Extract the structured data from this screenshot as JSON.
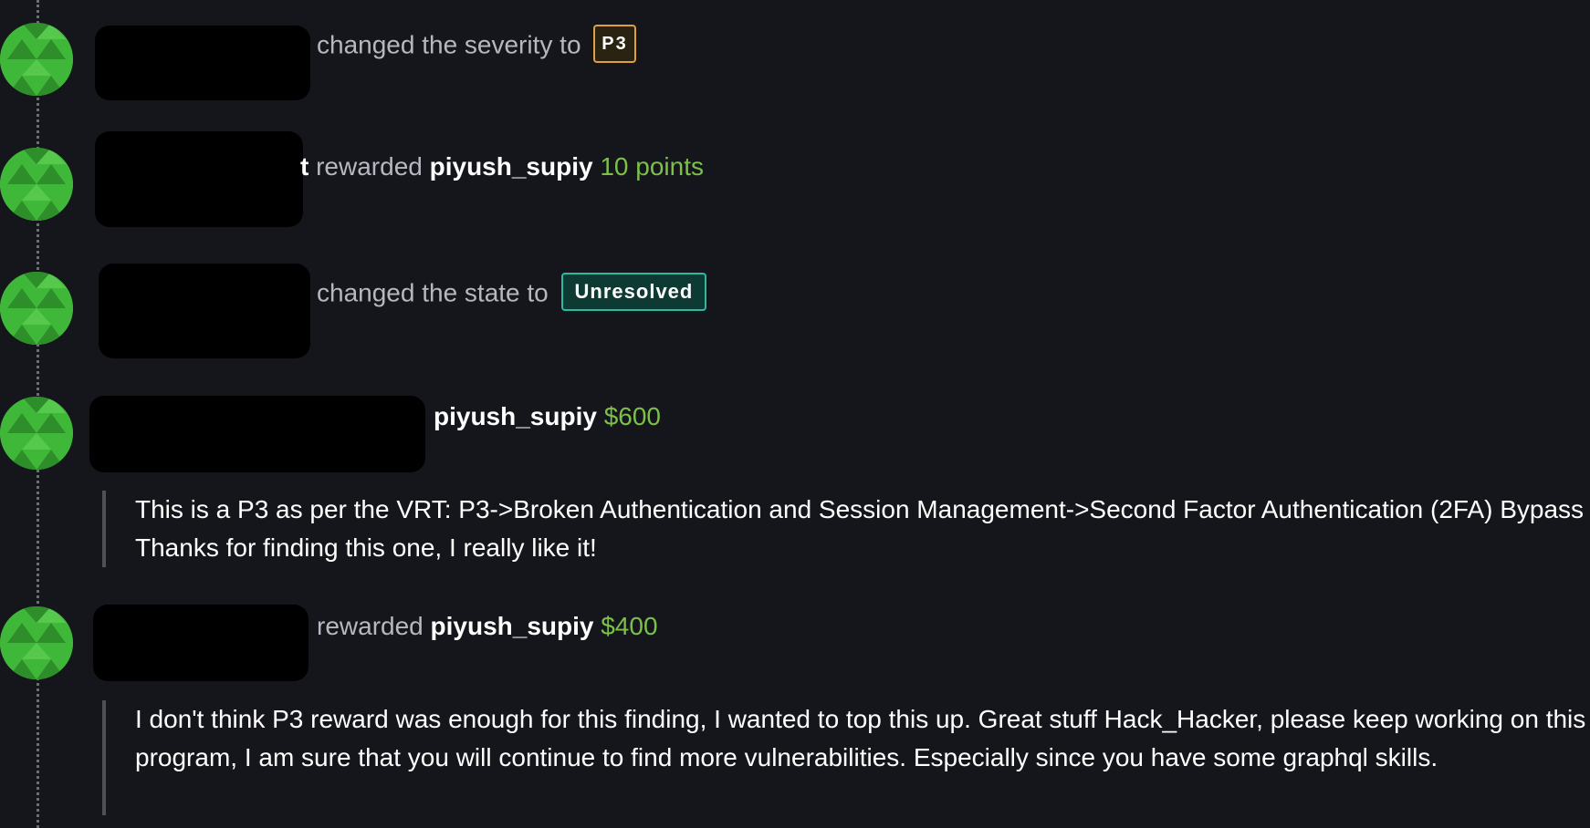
{
  "colors": {
    "background": "#15161c",
    "avatar_green": "#3fb83a",
    "amount_green": "#7cc04a",
    "severity_border": "#e0a040",
    "state_border": "#2fb8a0"
  },
  "events": [
    {
      "action_text": "changed the severity to",
      "severity_badge": "P3"
    },
    {
      "partial_text": "t",
      "action_text": "rewarded",
      "username": "piyush_supiy",
      "amount": "10 points"
    },
    {
      "action_text": "changed the state to",
      "state_badge": "Unresolved"
    },
    {
      "username": "piyush_supiy",
      "amount": "$600",
      "comment": "This is a P3 as per the VRT: P3->Broken Authentication and Session Management->Second Factor Authentication (2FA) Bypass Thanks for finding this one, I really like it!"
    },
    {
      "action_text": "rewarded",
      "username": "piyush_supiy",
      "amount": "$400",
      "comment": "I don't think P3 reward was enough for this finding, I wanted to top this up. Great stuff Hack_Hacker, please keep working on this program, I am sure that you will continue to find more vulnerabilities. Especially since you have some graphql skills."
    }
  ]
}
